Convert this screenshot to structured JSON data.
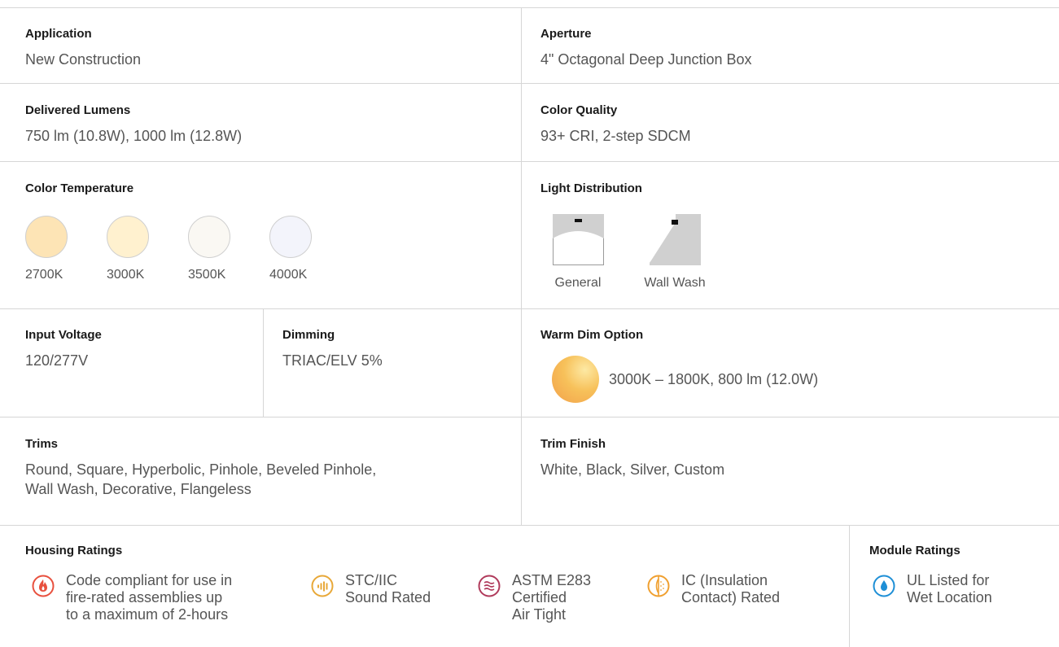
{
  "specs": {
    "application": {
      "label": "Application",
      "value": "New Construction"
    },
    "aperture": {
      "label": "Aperture",
      "value": "4\" Octagonal Deep Junction Box"
    },
    "delivered_lumens": {
      "label": "Delivered Lumens",
      "value": "750 lm (10.8W), 1000 lm (12.8W)"
    },
    "color_quality": {
      "label": "Color Quality",
      "value": "93+ CRI, 2-step SDCM"
    },
    "color_temperature": {
      "label": "Color Temperature",
      "options": [
        {
          "label": "2700K",
          "color": "#fde4b5"
        },
        {
          "label": "3000K",
          "color": "#fff1cf"
        },
        {
          "label": "3500K",
          "color": "#faf8f3"
        },
        {
          "label": "4000K",
          "color": "#f3f4fb"
        }
      ]
    },
    "light_distribution": {
      "label": "Light Distribution",
      "options": [
        {
          "label": "General",
          "icon": "general-distribution-icon"
        },
        {
          "label": "Wall Wash",
          "icon": "wall-wash-distribution-icon"
        }
      ]
    },
    "input_voltage": {
      "label": "Input Voltage",
      "value": "120/277V"
    },
    "dimming": {
      "label": "Dimming",
      "value": "TRIAC/ELV 5%"
    },
    "warm_dim": {
      "label": "Warm Dim Option",
      "value": "3000K – 1800K, 800 lm (12.0W)"
    },
    "trims": {
      "label": "Trims",
      "value_line1": "Round, Square, Hyperbolic, Pinhole, Beveled Pinhole,",
      "value_line2": "Wall Wash, Decorative, Flangeless"
    },
    "trim_finish": {
      "label": "Trim Finish",
      "value": "White, Black, Silver, Custom"
    }
  },
  "housing_ratings": {
    "label": "Housing Ratings",
    "items": [
      {
        "icon": "fire-icon",
        "color": "#e8503e",
        "lines": [
          "Code compliant for use in",
          "fire-rated assemblies up",
          "to a maximum of 2-hours"
        ]
      },
      {
        "icon": "sound-icon",
        "color": "#e8a838",
        "lines": [
          "STC/IIC",
          "Sound Rated"
        ]
      },
      {
        "icon": "air-tight-icon",
        "color": "#b03a5b",
        "lines": [
          "ASTM E283",
          "Certified",
          "Air Tight"
        ]
      },
      {
        "icon": "insulation-icon",
        "color": "#f0a030",
        "lines": [
          "IC (Insulation",
          "Contact) Rated"
        ]
      }
    ]
  },
  "module_ratings": {
    "label": "Module Ratings",
    "items": [
      {
        "icon": "water-drop-icon",
        "color": "#1e8fd6",
        "lines": [
          "UL Listed for",
          "Wet Location"
        ]
      }
    ]
  }
}
